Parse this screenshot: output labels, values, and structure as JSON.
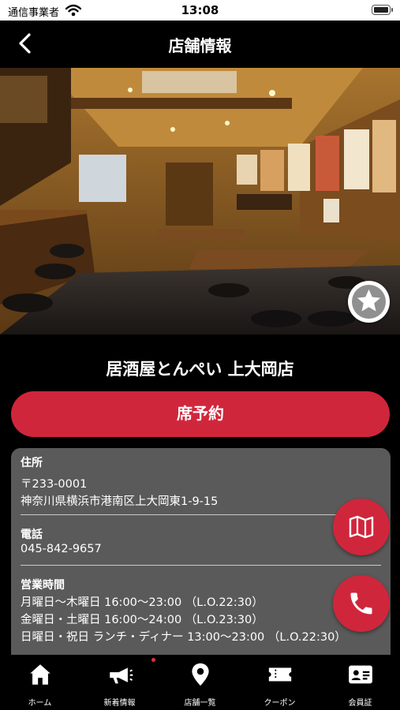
{
  "status_bar": {
    "carrier": "通信事業者",
    "time": "13:08"
  },
  "nav": {
    "title": "店舗情報",
    "back_icon": "chevron-left-icon"
  },
  "hero": {
    "image_alt": "restaurant-interior-photo",
    "favorite_icon": "star-icon"
  },
  "store": {
    "name": "居酒屋とんぺい 上大岡店"
  },
  "reserve_button": {
    "label": "席予約",
    "color": "#d0263c"
  },
  "info": {
    "address_label": "住所",
    "postal_code": "〒233-0001",
    "address": "神奈川県横浜市港南区上大岡東1-9-15",
    "phone_label": "電話",
    "phone": "045-842-9657",
    "hours_label": "営業時間",
    "hours": [
      "月曜日〜木曜日 16:00〜23:00 （L.O.22:30）",
      "金曜日・土曜日 16:00〜24:00 （L.O.23:30）",
      "日曜日・祝日 ランチ・ディナー 13:00〜23:00 （L.O.22:30）"
    ]
  },
  "fabs": {
    "map_icon": "map-icon",
    "phone_icon": "phone-icon"
  },
  "tabs": [
    {
      "label": "ホーム",
      "icon": "home-icon"
    },
    {
      "label": "新着情報",
      "icon": "megaphone-icon",
      "has_notification": true
    },
    {
      "label": "店舗一覧",
      "icon": "map-pin-icon"
    },
    {
      "label": "クーポン",
      "icon": "ticket-icon"
    },
    {
      "label": "会員証",
      "icon": "member-card-icon"
    }
  ],
  "colors": {
    "accent": "#d0263c",
    "card_background": "#5a5a5a",
    "background": "#000000"
  }
}
